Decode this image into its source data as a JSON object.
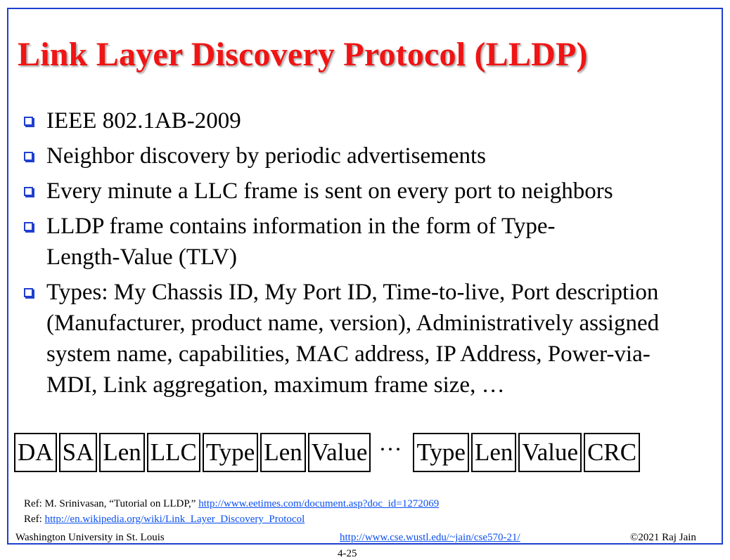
{
  "slide": {
    "title": "Link Layer Discovery Protocol (LLDP)",
    "bullets": [
      "IEEE 802.1AB-2009",
      "Neighbor discovery by periodic advertisements",
      "Every minute a LLC frame is sent on every port to neighbors",
      "LLDP frame contains information in the form of Type-Length-Value (TLV)",
      "Types: My Chassis ID, My Port ID, Time-to-live, Port description (Manufacturer, product name, version), Administratively assigned system name, capabilities, MAC address, IP Address, Power-via-MDI, Link aggregation, maximum frame size, …"
    ],
    "frame_fields": {
      "f1": "DA",
      "f2": "SA",
      "f3": "Len",
      "f4": "LLC",
      "f5": "Type",
      "f6": "Len",
      "f7": "Value",
      "ellipsis": "…",
      "f8": "Type",
      "f9": "Len",
      "f10": "Value",
      "f11": "CRC"
    },
    "refs": [
      {
        "prefix": "Ref: M. Srinivasan, “Tutorial on LLDP,” ",
        "link": "http://www.eetimes.com/document.asp?doc_id=1272069"
      },
      {
        "prefix": "Ref: ",
        "link": "http://en.wikipedia.org/wiki/Link_Layer_Discovery_Protocol"
      }
    ],
    "footer": {
      "left": "Washington University in St. Louis",
      "center_link": "http://www.cse.wustl.edu/~jain/cse570-21/",
      "right": "©2021 Raj Jain",
      "page_number": "4-25"
    },
    "colors": {
      "title": "#f01414",
      "border": "#1f3fd0",
      "link": "#0b4ff0"
    }
  }
}
